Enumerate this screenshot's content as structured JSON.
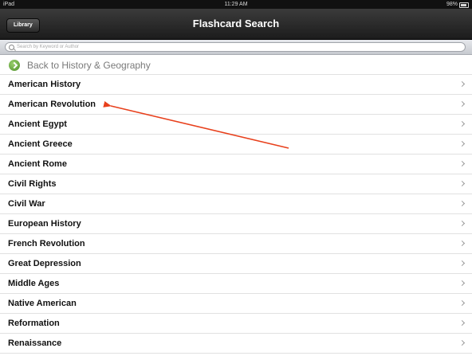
{
  "status_bar": {
    "carrier": "iPad",
    "time": "11:29 AM",
    "battery": "98%"
  },
  "nav": {
    "title": "Flashcard Search",
    "library_label": "Library"
  },
  "search": {
    "placeholder": "Search by Keyword or Author"
  },
  "back": {
    "label": "Back to History & Geography"
  },
  "list": {
    "items": [
      "American History",
      "American Revolution",
      "Ancient Egypt",
      "Ancient Greece",
      "Ancient Rome",
      "Civil Rights",
      "Civil War",
      "European History",
      "French Revolution",
      "Great Depression",
      "Middle Ages",
      "Native American",
      "Reformation",
      "Renaissance"
    ]
  },
  "annotation": {
    "color": "#e8401c",
    "target": "American Revolution"
  }
}
